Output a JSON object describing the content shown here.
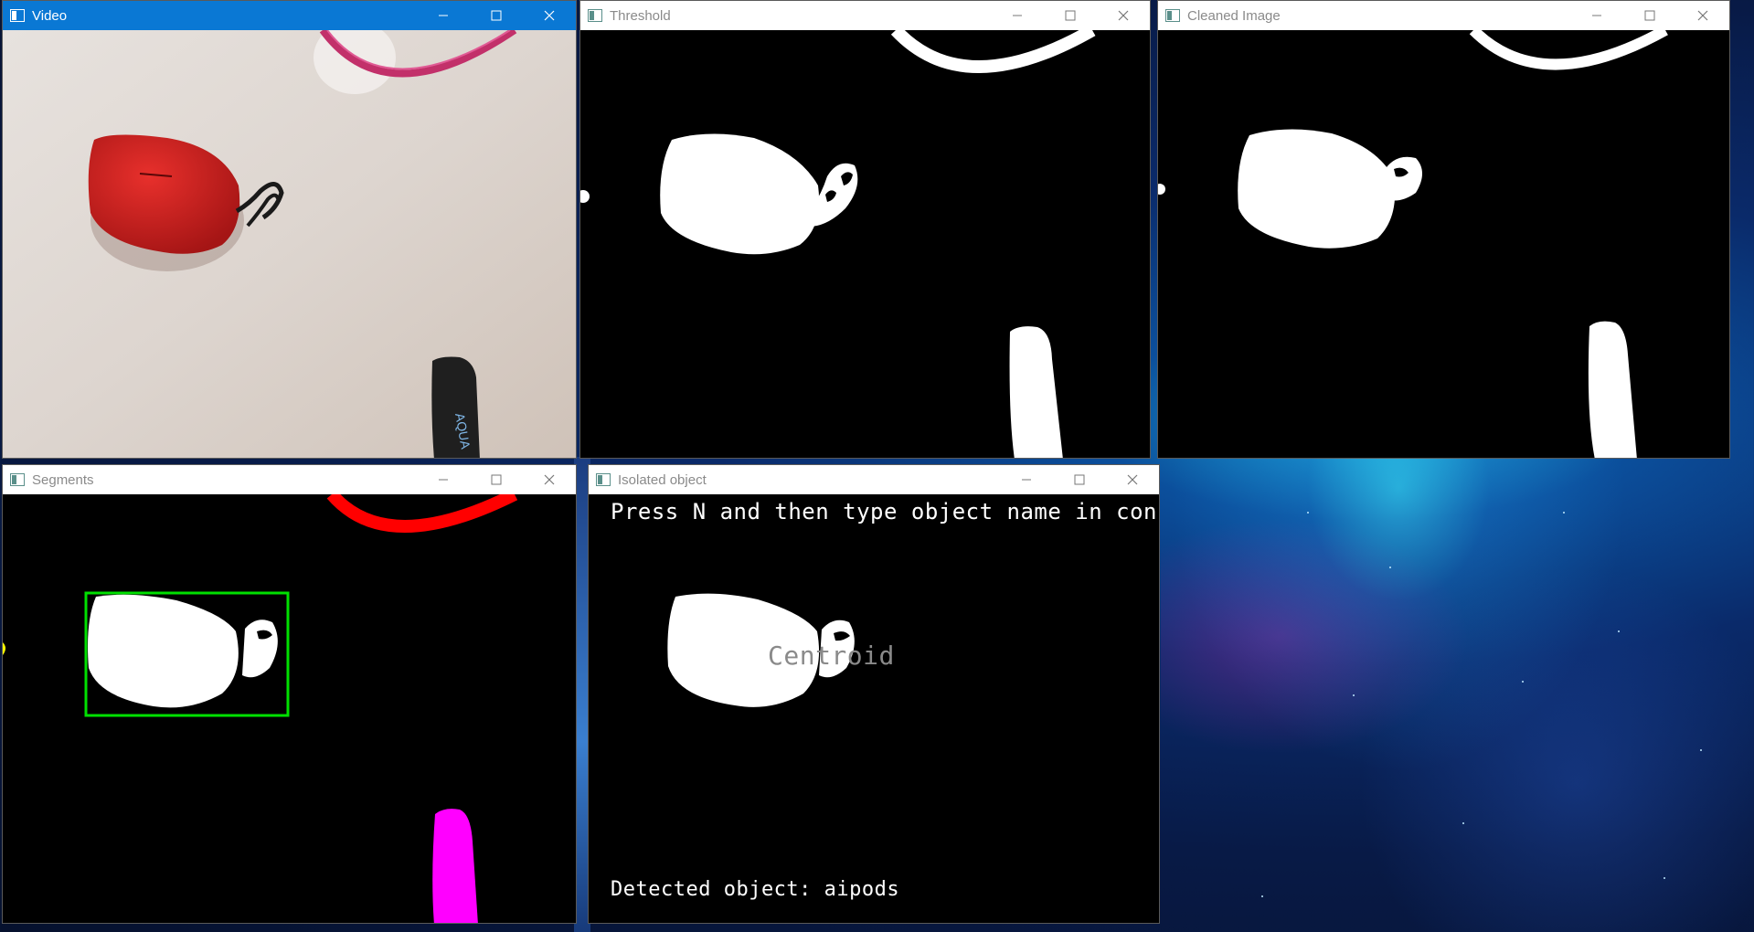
{
  "windows": {
    "video": {
      "title": "Video",
      "active": true
    },
    "threshold": {
      "title": "Threshold"
    },
    "cleaned": {
      "title": "Cleaned Image"
    },
    "segments": {
      "title": "Segments"
    },
    "isolated": {
      "title": "Isolated object",
      "instruction": "Press N and then type object name in console",
      "centroid_label": "Centroid",
      "detected_text": "Detected object: aipods"
    }
  },
  "icons": {
    "app": "window-app-icon",
    "minimize": "minimize-icon",
    "maximize": "maximize-icon",
    "close": "close-icon"
  },
  "colors": {
    "active_titlebar": "#0a78d4",
    "bounding_box": "#00e000",
    "segment_red": "#ff0000",
    "segment_magenta": "#ff00ff",
    "segment_yellow": "#ffff00"
  }
}
